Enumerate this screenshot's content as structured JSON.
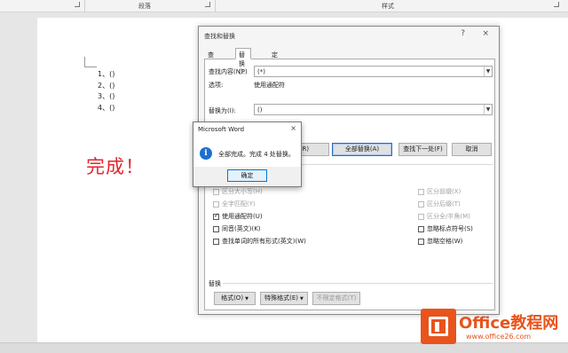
{
  "ribbon": {
    "group_paragraph": "段落",
    "group_styles": "样式"
  },
  "document": {
    "list_items": [
      "1、()",
      "2、()",
      "3、()",
      "4、()"
    ],
    "done_text": "完成！",
    "done_color": "#e2262c"
  },
  "find_replace": {
    "title": "查找和替换",
    "help_icon": "?",
    "close_icon": "×",
    "tabs": [
      {
        "label": "查找(D)",
        "active": false
      },
      {
        "label": "替换(P)",
        "active": true
      },
      {
        "label": "定位(G)",
        "active": false
      }
    ],
    "find_label": "查找内容(N):",
    "find_value": "(*)",
    "options_label": "选项:",
    "options_value": "使用通配符",
    "replace_label": "替换为(I):",
    "replace_value": "()",
    "buttons": {
      "replace": "替换(R)",
      "replace_all": "全部替换(A)",
      "find_next": "查找下一处(F)",
      "cancel": "取消"
    },
    "checkboxes_left": [
      {
        "label": "区分大小写(H)",
        "checked": false,
        "disabled": true
      },
      {
        "label": "全字匹配(Y)",
        "checked": false,
        "disabled": true
      },
      {
        "label": "使用通配符(U)",
        "checked": true,
        "disabled": false
      },
      {
        "label": "同音(英文)(K)",
        "checked": false,
        "disabled": false
      },
      {
        "label": "查找单词的所有形式(英文)(W)",
        "checked": false,
        "disabled": false
      }
    ],
    "checkboxes_right": [
      {
        "label": "区分前缀(X)",
        "checked": false,
        "disabled": true
      },
      {
        "label": "区分后缀(T)",
        "checked": false,
        "disabled": true
      },
      {
        "label": "区分全/半角(M)",
        "checked": false,
        "disabled": true
      },
      {
        "label": "忽略标点符号(S)",
        "checked": false,
        "disabled": false
      },
      {
        "label": "忽略空格(W)",
        "checked": false,
        "disabled": false
      }
    ],
    "replace_section_label": "替换",
    "bottom_buttons": {
      "format": "格式(O)",
      "special": "特殊格式(E)",
      "no_format": "不限定格式(T)"
    }
  },
  "message_box": {
    "title": "Microsoft Word",
    "close_icon": "×",
    "icon": "i",
    "message": "全部完成。完成 4 处替换。",
    "ok_label": "确定"
  },
  "watermark": {
    "name": "Office教程网",
    "site": "www.office26.com"
  },
  "colors": {
    "accent": "#0078d7",
    "info_icon": "#1c6fd0",
    "watermark": "#e8541c"
  }
}
